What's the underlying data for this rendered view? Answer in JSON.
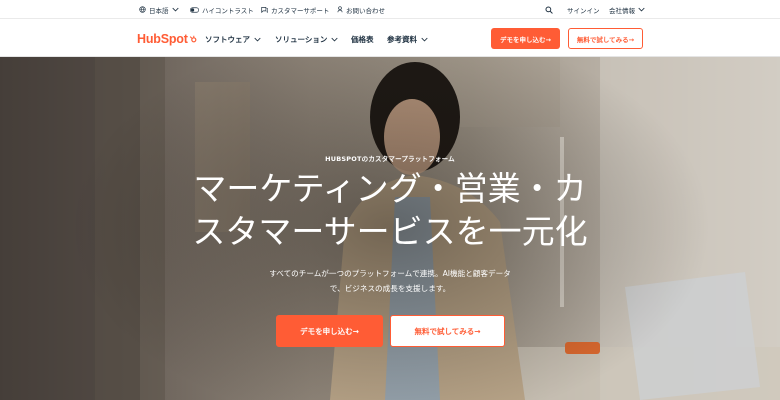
{
  "utility": {
    "language": "日本語",
    "contrast": "ハイコントラスト",
    "support": "カスタマーサポート",
    "contact": "お問い合わせ",
    "signin": "サインイン",
    "company": "会社情報"
  },
  "nav": {
    "logo": "HubSpot",
    "items": [
      "ソフトウェア",
      "ソリューション",
      "価格表",
      "参考資料"
    ],
    "demo_button": "デモを申し込む→",
    "free_button": "無料で試してみる→"
  },
  "hero": {
    "eyebrow": "HUBSPOTのカスタマープラットフォーム",
    "headline_line1": "マーケティング・営業・カ",
    "headline_line2": "スタマーサービスを一元化",
    "subtext_line1": "すべてのチームが一つのプラットフォームで連携。AI機能と顧客データ",
    "subtext_line2": "で、ビジネスの成長を支援します。",
    "demo_button": "デモを申し込む→",
    "free_button": "無料で試してみる→"
  },
  "colors": {
    "accent": "#ff5c35",
    "text": "#213343"
  },
  "icons": [
    "globe-icon",
    "contrast-toggle-icon",
    "support-icon",
    "contact-icon",
    "search-icon",
    "chevron-down-icon",
    "sprocket-icon"
  ]
}
